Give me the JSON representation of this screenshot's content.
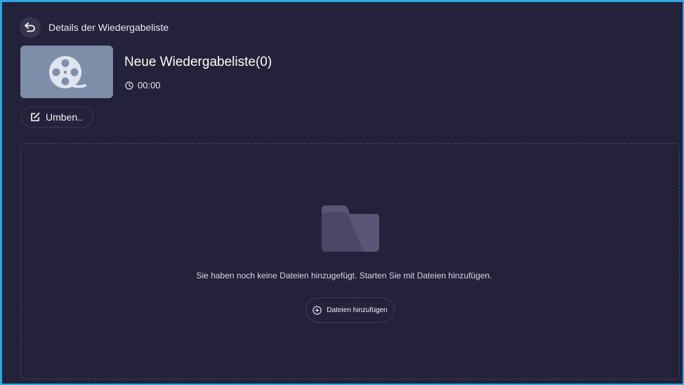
{
  "header": {
    "title": "Details der Wiedergabeliste",
    "back_icon": "return-arrow-icon"
  },
  "playlist": {
    "title": "Neue Wiedergabeliste(0)",
    "duration": "00:00",
    "thumbnail_icon": "film-reel-icon",
    "duration_icon": "clock-icon"
  },
  "actions": {
    "rename_label": "Umben..",
    "rename_icon": "edit-icon"
  },
  "empty_state": {
    "icon": "folder-icon",
    "message": "Sie haben noch keine Dateien hinzugefügt. Starten Sie mit Dateien hinzufügen.",
    "add_label": "Dateien hinzufügen",
    "add_icon": "plus-circle-icon"
  },
  "colors": {
    "background": "#23223a",
    "accent_border": "#2aa9e0",
    "thumbnail": "#7e8ea8",
    "folder": "#5a5577"
  }
}
